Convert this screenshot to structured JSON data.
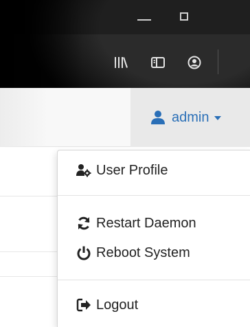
{
  "browser": {
    "icons": [
      "library-icon",
      "sidebar-icon",
      "account-icon"
    ]
  },
  "navbar": {
    "user": {
      "name": "admin",
      "icon": "user-icon",
      "color": "#2a6fb7"
    }
  },
  "dropdown": {
    "items": [
      {
        "label": "User Profile",
        "icon": "user-cog-icon"
      },
      {
        "label": "Restart Daemon",
        "icon": "refresh-icon"
      },
      {
        "label": "Reboot System",
        "icon": "power-icon"
      },
      {
        "label": "Logout",
        "icon": "sign-out-icon"
      }
    ]
  }
}
